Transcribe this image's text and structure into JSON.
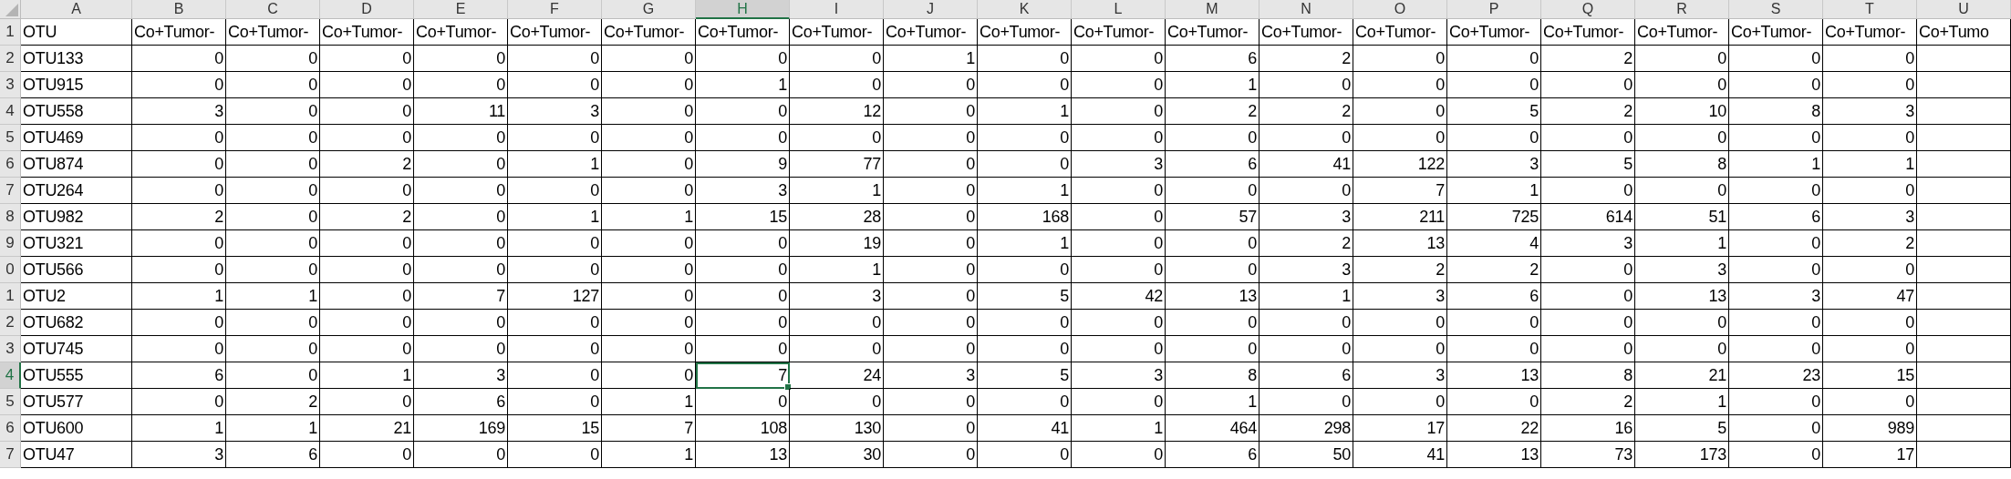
{
  "columns": [
    {
      "letter": "A",
      "selected": false
    },
    {
      "letter": "B",
      "selected": false
    },
    {
      "letter": "C",
      "selected": false
    },
    {
      "letter": "D",
      "selected": false
    },
    {
      "letter": "E",
      "selected": false
    },
    {
      "letter": "F",
      "selected": false
    },
    {
      "letter": "G",
      "selected": false
    },
    {
      "letter": "H",
      "selected": true
    },
    {
      "letter": "I",
      "selected": false
    },
    {
      "letter": "J",
      "selected": false
    },
    {
      "letter": "K",
      "selected": false
    },
    {
      "letter": "L",
      "selected": false
    },
    {
      "letter": "M",
      "selected": false
    },
    {
      "letter": "N",
      "selected": false
    },
    {
      "letter": "O",
      "selected": false
    },
    {
      "letter": "P",
      "selected": false
    },
    {
      "letter": "Q",
      "selected": false
    },
    {
      "letter": "R",
      "selected": false
    },
    {
      "letter": "S",
      "selected": false
    },
    {
      "letter": "T",
      "selected": false
    },
    {
      "letter": "U",
      "selected": false
    }
  ],
  "rows": [
    {
      "number": "1",
      "selected": false,
      "cells": [
        "OTU",
        "Co+Tumor-",
        "Co+Tumor-",
        "Co+Tumor-",
        "Co+Tumor-",
        "Co+Tumor-",
        "Co+Tumor-",
        "Co+Tumor-",
        "Co+Tumor-",
        "Co+Tumor-",
        "Co+Tumor-",
        "Co+Tumor-",
        "Co+Tumor-",
        "Co+Tumor-",
        "Co+Tumor-",
        "Co+Tumor-",
        "Co+Tumor-",
        "Co+Tumor-",
        "Co+Tumor-",
        "Co+Tumor-",
        "Co+Tumo"
      ]
    },
    {
      "number": "2",
      "selected": false,
      "cells": [
        "OTU133",
        "0",
        "0",
        "0",
        "0",
        "0",
        "0",
        "0",
        "0",
        "1",
        "0",
        "0",
        "6",
        "2",
        "0",
        "0",
        "2",
        "0",
        "0",
        "0"
      ]
    },
    {
      "number": "3",
      "selected": false,
      "cells": [
        "OTU915",
        "0",
        "0",
        "0",
        "0",
        "0",
        "0",
        "1",
        "0",
        "0",
        "0",
        "0",
        "1",
        "0",
        "0",
        "0",
        "0",
        "0",
        "0",
        "0"
      ]
    },
    {
      "number": "4",
      "selected": false,
      "cells": [
        "OTU558",
        "3",
        "0",
        "0",
        "11",
        "3",
        "0",
        "0",
        "12",
        "0",
        "1",
        "0",
        "2",
        "2",
        "0",
        "5",
        "2",
        "10",
        "8",
        "3"
      ]
    },
    {
      "number": "5",
      "selected": false,
      "cells": [
        "OTU469",
        "0",
        "0",
        "0",
        "0",
        "0",
        "0",
        "0",
        "0",
        "0",
        "0",
        "0",
        "0",
        "0",
        "0",
        "0",
        "0",
        "0",
        "0",
        "0"
      ]
    },
    {
      "number": "6",
      "selected": false,
      "cells": [
        "OTU874",
        "0",
        "0",
        "2",
        "0",
        "1",
        "0",
        "9",
        "77",
        "0",
        "0",
        "3",
        "6",
        "41",
        "122",
        "3",
        "5",
        "8",
        "1",
        "1"
      ]
    },
    {
      "number": "7",
      "selected": false,
      "cells": [
        "OTU264",
        "0",
        "0",
        "0",
        "0",
        "0",
        "0",
        "3",
        "1",
        "0",
        "1",
        "0",
        "0",
        "0",
        "7",
        "1",
        "0",
        "0",
        "0",
        "0"
      ]
    },
    {
      "number": "8",
      "selected": false,
      "cells": [
        "OTU982",
        "2",
        "0",
        "2",
        "0",
        "1",
        "1",
        "15",
        "28",
        "0",
        "168",
        "0",
        "57",
        "3",
        "211",
        "725",
        "614",
        "51",
        "6",
        "3"
      ]
    },
    {
      "number": "9",
      "selected": false,
      "cells": [
        "OTU321",
        "0",
        "0",
        "0",
        "0",
        "0",
        "0",
        "0",
        "19",
        "0",
        "1",
        "0",
        "0",
        "2",
        "13",
        "4",
        "3",
        "1",
        "0",
        "2"
      ]
    },
    {
      "number": "0",
      "selected": false,
      "cells": [
        "OTU566",
        "0",
        "0",
        "0",
        "0",
        "0",
        "0",
        "0",
        "1",
        "0",
        "0",
        "0",
        "0",
        "3",
        "2",
        "2",
        "0",
        "3",
        "0",
        "0"
      ]
    },
    {
      "number": "1",
      "selected": false,
      "cells": [
        "OTU2",
        "1",
        "1",
        "0",
        "7",
        "127",
        "0",
        "0",
        "3",
        "0",
        "5",
        "42",
        "13",
        "1",
        "3",
        "6",
        "0",
        "13",
        "3",
        "47"
      ]
    },
    {
      "number": "2",
      "selected": false,
      "cells": [
        "OTU682",
        "0",
        "0",
        "0",
        "0",
        "0",
        "0",
        "0",
        "0",
        "0",
        "0",
        "0",
        "0",
        "0",
        "0",
        "0",
        "0",
        "0",
        "0",
        "0"
      ]
    },
    {
      "number": "3",
      "selected": false,
      "cells": [
        "OTU745",
        "0",
        "0",
        "0",
        "0",
        "0",
        "0",
        "0",
        "0",
        "0",
        "0",
        "0",
        "0",
        "0",
        "0",
        "0",
        "0",
        "0",
        "0",
        "0"
      ]
    },
    {
      "number": "4",
      "selected": true,
      "cells": [
        "OTU555",
        "6",
        "0",
        "1",
        "3",
        "0",
        "0",
        "7",
        "24",
        "3",
        "5",
        "3",
        "8",
        "6",
        "3",
        "13",
        "8",
        "21",
        "23",
        "15"
      ]
    },
    {
      "number": "5",
      "selected": false,
      "cells": [
        "OTU577",
        "0",
        "2",
        "0",
        "6",
        "0",
        "1",
        "0",
        "0",
        "0",
        "0",
        "0",
        "1",
        "0",
        "0",
        "0",
        "2",
        "1",
        "0",
        "0"
      ]
    },
    {
      "number": "6",
      "selected": false,
      "cells": [
        "OTU600",
        "1",
        "1",
        "21",
        "169",
        "15",
        "7",
        "108",
        "130",
        "0",
        "41",
        "1",
        "464",
        "298",
        "17",
        "22",
        "16",
        "5",
        "0",
        "989"
      ]
    },
    {
      "number": "7",
      "selected": false,
      "cells": [
        "OTU47",
        "3",
        "6",
        "0",
        "0",
        "0",
        "1",
        "13",
        "30",
        "0",
        "0",
        "0",
        "6",
        "50",
        "41",
        "13",
        "73",
        "173",
        "0",
        "17"
      ]
    }
  ]
}
